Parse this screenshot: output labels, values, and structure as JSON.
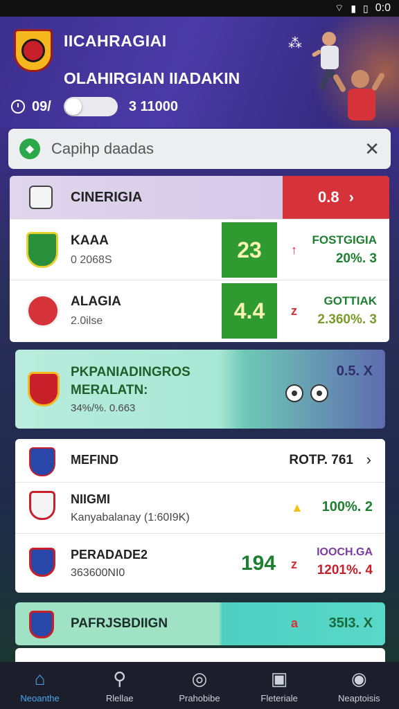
{
  "status": {
    "time": "0:0"
  },
  "header": {
    "title": "IICAHRAGIAI",
    "subtitle": "OLAHIRGIAN IIADAKIN",
    "clock_value": "09/",
    "toggle_right": "3 11000"
  },
  "search": {
    "placeholder": "Capihp daadas"
  },
  "section1": {
    "label": "CINERIGIA",
    "right_value": "0.8",
    "rows": [
      {
        "name": "KAAA",
        "sub": "0 2068S",
        "score": "23",
        "arrow": "↑",
        "right_top": "FOSTGIGIA",
        "right_bot": "20%. 3"
      },
      {
        "name": "ALAGIA",
        "sub": "2.0ilse",
        "score": "4.4",
        "arrow": "z",
        "right_top": "GOTTIAK",
        "right_bot": "2.360%. 3"
      }
    ]
  },
  "promo": {
    "title": "PKPANIADINGROS MERALATN:",
    "sub": "34%/%. 0.663",
    "right": "0.5. X"
  },
  "section2": {
    "head_label": "MEFIND",
    "head_right": "ROTP. 761",
    "rows": [
      {
        "name": "NIIGMI",
        "sub": "Kanyabalanay (1:60I9K)",
        "right": "100%. 2"
      },
      {
        "name": "PERADADE2",
        "sub": "363600NI0",
        "score": "194",
        "arrow": "z",
        "right_top": "IOOCH.GA",
        "right_bot": "1201%. 4"
      }
    ]
  },
  "footer_row": {
    "name": "PAFRJSBDIIGN",
    "arrow": "a",
    "value": "35I3. X"
  },
  "nav": [
    {
      "label": "Neoanthe",
      "icon": "home-icon"
    },
    {
      "label": "Rlellae",
      "icon": "search-icon"
    },
    {
      "label": "Prahobibe",
      "icon": "compass-icon"
    },
    {
      "label": "Fleteriale",
      "icon": "image-icon"
    },
    {
      "label": "Neaptoisis",
      "icon": "profile-icon"
    }
  ],
  "colors": {
    "accent": "#4aa8f0",
    "win": "#2f9a2f",
    "alert": "#d6323a"
  }
}
